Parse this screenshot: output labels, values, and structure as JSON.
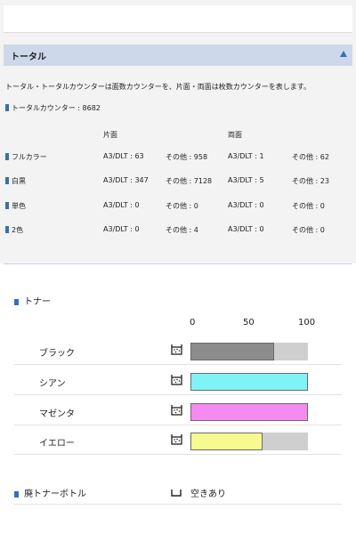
{
  "total_section": {
    "title": "トータル",
    "description": "トータル・トータルカウンターは面数カウンターを、片面・両面は枚数カウンターを表します。",
    "total_counter": "トータルカウンター : 8682",
    "columns": {
      "single": "片面",
      "double": "両面"
    },
    "rows": [
      {
        "label": "フルカラー",
        "single_a3": "A3/DLT : 63",
        "single_other": "その他 : 958",
        "double_a3": "A3/DLT : 1",
        "double_other": "その他 : 62"
      },
      {
        "label": "白黒",
        "single_a3": "A3/DLT : 347",
        "single_other": "その他 : 7128",
        "double_a3": "A3/DLT : 5",
        "double_other": "その他 : 23"
      },
      {
        "label": "単色",
        "single_a3": "A3/DLT : 0",
        "single_other": "その他 : 0",
        "double_a3": "A3/DLT : 0",
        "double_other": "その他 : 0"
      },
      {
        "label": "2色",
        "single_a3": "A3/DLT : 0",
        "single_other": "その他 : 4",
        "double_a3": "A3/DLT : 0",
        "double_other": "その他 : 0"
      }
    ]
  },
  "toner": {
    "title": "トナー",
    "scale": [
      "0",
      "50",
      "100"
    ],
    "items": [
      {
        "name": "ブラック",
        "level": 0.71,
        "color": "#8c8c8c"
      },
      {
        "name": "シアン",
        "level": 1.0,
        "color": "#7ff3f6"
      },
      {
        "name": "マゼンタ",
        "level": 1.0,
        "color": "#f58af2"
      },
      {
        "name": "イエロー",
        "level": 0.61,
        "color": "#f7fb8f"
      }
    ]
  },
  "waste_toner": {
    "label": "廃トナーボトル",
    "status": "空きあり"
  },
  "colors": {
    "header_bar": "#cdd9ea",
    "accent": "#3a6fb0",
    "bar_track": "#cfcfcf"
  }
}
